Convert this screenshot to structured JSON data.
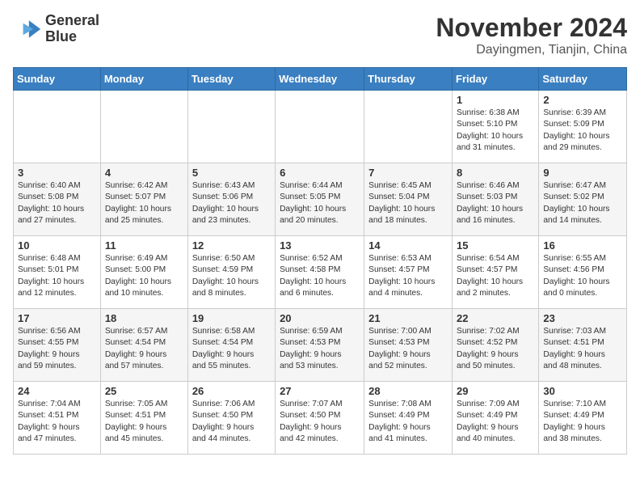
{
  "header": {
    "logo_line1": "General",
    "logo_line2": "Blue",
    "month": "November 2024",
    "location": "Dayingmen, Tianjin, China"
  },
  "weekdays": [
    "Sunday",
    "Monday",
    "Tuesday",
    "Wednesday",
    "Thursday",
    "Friday",
    "Saturday"
  ],
  "weeks": [
    [
      {
        "day": "",
        "info": ""
      },
      {
        "day": "",
        "info": ""
      },
      {
        "day": "",
        "info": ""
      },
      {
        "day": "",
        "info": ""
      },
      {
        "day": "",
        "info": ""
      },
      {
        "day": "1",
        "info": "Sunrise: 6:38 AM\nSunset: 5:10 PM\nDaylight: 10 hours\nand 31 minutes."
      },
      {
        "day": "2",
        "info": "Sunrise: 6:39 AM\nSunset: 5:09 PM\nDaylight: 10 hours\nand 29 minutes."
      }
    ],
    [
      {
        "day": "3",
        "info": "Sunrise: 6:40 AM\nSunset: 5:08 PM\nDaylight: 10 hours\nand 27 minutes."
      },
      {
        "day": "4",
        "info": "Sunrise: 6:42 AM\nSunset: 5:07 PM\nDaylight: 10 hours\nand 25 minutes."
      },
      {
        "day": "5",
        "info": "Sunrise: 6:43 AM\nSunset: 5:06 PM\nDaylight: 10 hours\nand 23 minutes."
      },
      {
        "day": "6",
        "info": "Sunrise: 6:44 AM\nSunset: 5:05 PM\nDaylight: 10 hours\nand 20 minutes."
      },
      {
        "day": "7",
        "info": "Sunrise: 6:45 AM\nSunset: 5:04 PM\nDaylight: 10 hours\nand 18 minutes."
      },
      {
        "day": "8",
        "info": "Sunrise: 6:46 AM\nSunset: 5:03 PM\nDaylight: 10 hours\nand 16 minutes."
      },
      {
        "day": "9",
        "info": "Sunrise: 6:47 AM\nSunset: 5:02 PM\nDaylight: 10 hours\nand 14 minutes."
      }
    ],
    [
      {
        "day": "10",
        "info": "Sunrise: 6:48 AM\nSunset: 5:01 PM\nDaylight: 10 hours\nand 12 minutes."
      },
      {
        "day": "11",
        "info": "Sunrise: 6:49 AM\nSunset: 5:00 PM\nDaylight: 10 hours\nand 10 minutes."
      },
      {
        "day": "12",
        "info": "Sunrise: 6:50 AM\nSunset: 4:59 PM\nDaylight: 10 hours\nand 8 minutes."
      },
      {
        "day": "13",
        "info": "Sunrise: 6:52 AM\nSunset: 4:58 PM\nDaylight: 10 hours\nand 6 minutes."
      },
      {
        "day": "14",
        "info": "Sunrise: 6:53 AM\nSunset: 4:57 PM\nDaylight: 10 hours\nand 4 minutes."
      },
      {
        "day": "15",
        "info": "Sunrise: 6:54 AM\nSunset: 4:57 PM\nDaylight: 10 hours\nand 2 minutes."
      },
      {
        "day": "16",
        "info": "Sunrise: 6:55 AM\nSunset: 4:56 PM\nDaylight: 10 hours\nand 0 minutes."
      }
    ],
    [
      {
        "day": "17",
        "info": "Sunrise: 6:56 AM\nSunset: 4:55 PM\nDaylight: 9 hours\nand 59 minutes."
      },
      {
        "day": "18",
        "info": "Sunrise: 6:57 AM\nSunset: 4:54 PM\nDaylight: 9 hours\nand 57 minutes."
      },
      {
        "day": "19",
        "info": "Sunrise: 6:58 AM\nSunset: 4:54 PM\nDaylight: 9 hours\nand 55 minutes."
      },
      {
        "day": "20",
        "info": "Sunrise: 6:59 AM\nSunset: 4:53 PM\nDaylight: 9 hours\nand 53 minutes."
      },
      {
        "day": "21",
        "info": "Sunrise: 7:00 AM\nSunset: 4:53 PM\nDaylight: 9 hours\nand 52 minutes."
      },
      {
        "day": "22",
        "info": "Sunrise: 7:02 AM\nSunset: 4:52 PM\nDaylight: 9 hours\nand 50 minutes."
      },
      {
        "day": "23",
        "info": "Sunrise: 7:03 AM\nSunset: 4:51 PM\nDaylight: 9 hours\nand 48 minutes."
      }
    ],
    [
      {
        "day": "24",
        "info": "Sunrise: 7:04 AM\nSunset: 4:51 PM\nDaylight: 9 hours\nand 47 minutes."
      },
      {
        "day": "25",
        "info": "Sunrise: 7:05 AM\nSunset: 4:51 PM\nDaylight: 9 hours\nand 45 minutes."
      },
      {
        "day": "26",
        "info": "Sunrise: 7:06 AM\nSunset: 4:50 PM\nDaylight: 9 hours\nand 44 minutes."
      },
      {
        "day": "27",
        "info": "Sunrise: 7:07 AM\nSunset: 4:50 PM\nDaylight: 9 hours\nand 42 minutes."
      },
      {
        "day": "28",
        "info": "Sunrise: 7:08 AM\nSunset: 4:49 PM\nDaylight: 9 hours\nand 41 minutes."
      },
      {
        "day": "29",
        "info": "Sunrise: 7:09 AM\nSunset: 4:49 PM\nDaylight: 9 hours\nand 40 minutes."
      },
      {
        "day": "30",
        "info": "Sunrise: 7:10 AM\nSunset: 4:49 PM\nDaylight: 9 hours\nand 38 minutes."
      }
    ]
  ]
}
